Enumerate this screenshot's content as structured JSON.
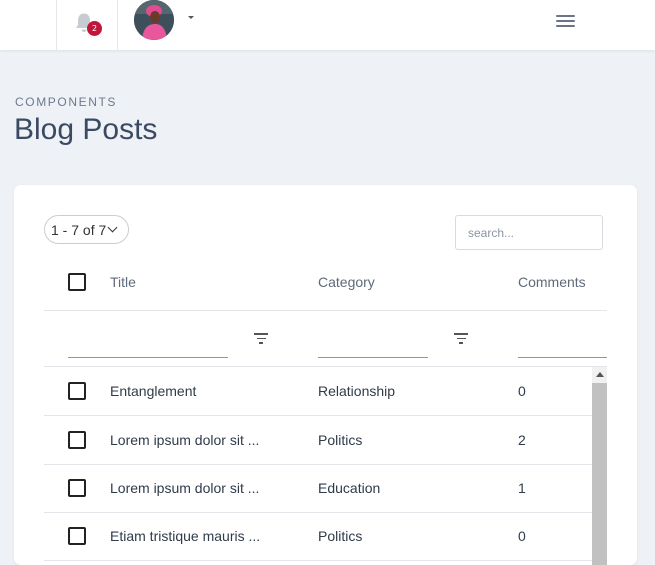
{
  "topbar": {
    "notification_count": "2",
    "icons": [
      "bell-icon",
      "caret-down-icon",
      "hamburger-menu-icon"
    ]
  },
  "header": {
    "breadcrumb": "COMPONENTS",
    "title": "Blog Posts"
  },
  "table": {
    "pagination": "1 - 7 of 7",
    "search_placeholder": "search...",
    "columns": [
      "Title",
      "Category",
      "Comments"
    ],
    "rows": [
      {
        "title": "Entanglement",
        "category": "Relationship",
        "comments": "0"
      },
      {
        "title": "Lorem ipsum dolor sit ...",
        "category": "Politics",
        "comments": "2"
      },
      {
        "title": "Lorem ipsum dolor sit ...",
        "category": "Education",
        "comments": "1"
      },
      {
        "title": "Etiam tristique mauris ...",
        "category": "Politics",
        "comments": "0"
      }
    ]
  },
  "colors": {
    "badge": "#c0163c",
    "title": "#3b4a63",
    "background": "#eef1f5"
  }
}
